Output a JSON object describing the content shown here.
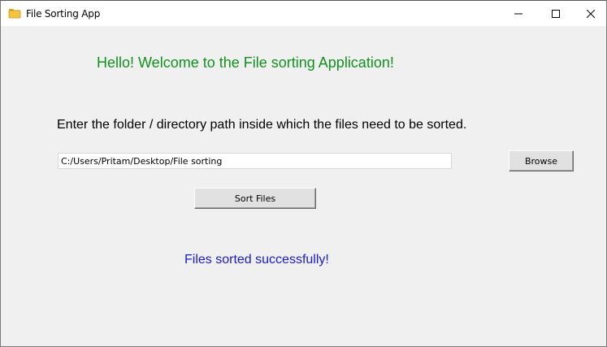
{
  "window": {
    "title": "File Sorting App",
    "icon": "folder-icon"
  },
  "titlebar_buttons": {
    "minimize": "minimize-icon",
    "maximize": "maximize-icon",
    "close": "close-icon"
  },
  "main": {
    "welcome_text": "Hello! Welcome to the File sorting Application!",
    "instruction_text": "Enter the folder / directory path inside which the files need to be sorted.",
    "path_value": "C:/Users/Pritam/Desktop/File sorting",
    "browse_label": "Browse",
    "sort_label": "Sort Files",
    "status_text": "Files sorted successfully!"
  },
  "colors": {
    "welcome": "#10921e",
    "status": "#1a1ad6",
    "window_bg": "#f0f0f0",
    "folder_yellow": "#f5c542"
  }
}
